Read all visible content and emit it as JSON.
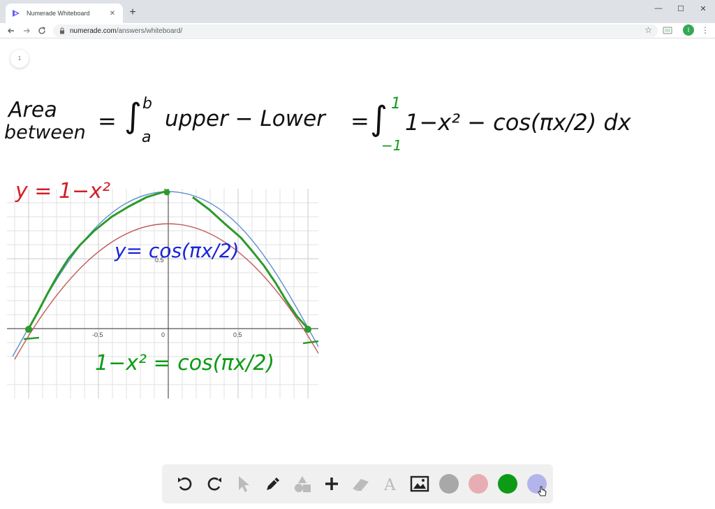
{
  "browser": {
    "tab_title": "Numerade Whiteboard",
    "tab_close": "✕",
    "new_tab": "+",
    "url_domain": "numerade.com",
    "url_path": "/answers/whiteboard/",
    "profile_initial": "I",
    "window_controls": [
      "—",
      "☐",
      "✕"
    ]
  },
  "whiteboard": {
    "page_number": "1",
    "formula": {
      "area_label_1": "Area",
      "area_label_2": "between",
      "eq1": "=",
      "integral_sign": "∫",
      "upper_limit_b": "b",
      "lower_limit_a": "a",
      "upper_minus_lower": "upper − Lower",
      "eq2": "=",
      "upper_limit_1": "1",
      "lower_limit_neg1": "−1",
      "integrand": "1−x² − cos(πx/2) dx"
    },
    "labels": {
      "parabola": "y = 1−x²",
      "cosine": "y= cos(πx/2)",
      "intersection_eq": "1−x² = cos(πx/2)"
    },
    "graph": {
      "tick_neg05": "-0.5",
      "tick_0": "0",
      "tick_05": "0.5",
      "tick_y05": "0.5",
      "tick_y1": "1"
    }
  },
  "tools": {
    "icons": [
      "undo-icon",
      "redo-icon",
      "pointer-icon",
      "pen-icon",
      "shapes-icon",
      "add-icon",
      "eraser-icon",
      "text-icon",
      "image-icon"
    ],
    "colors": {
      "gray": "#a8a8a8",
      "pink": "#e8adb2",
      "green": "#0e9a16",
      "lavender": "#b4b4ec"
    }
  }
}
